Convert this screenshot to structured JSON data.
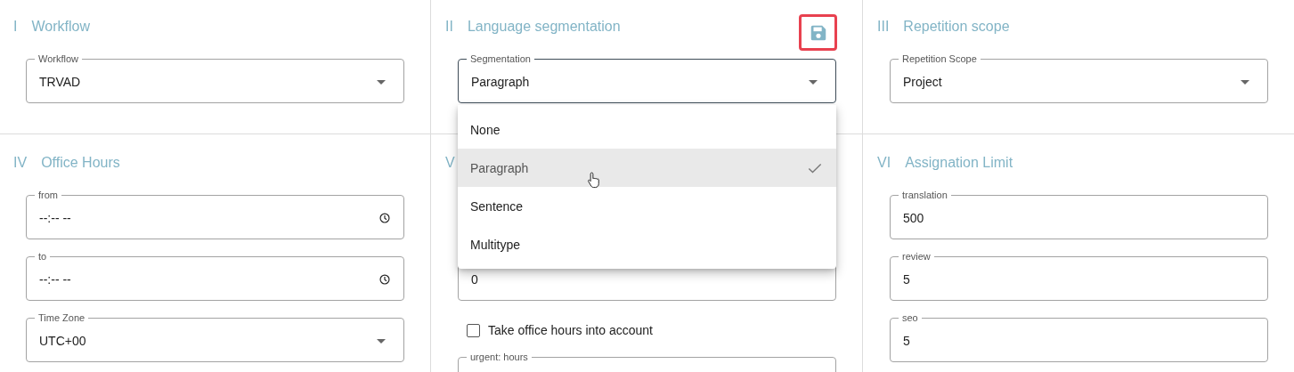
{
  "sections": [
    {
      "numeral": "I",
      "title": "Workflow",
      "fields": [
        {
          "kind": "select",
          "label": "Workflow",
          "value": "TRVAD"
        }
      ]
    },
    {
      "numeral": "II",
      "title": "Language segmentation",
      "save_button": true,
      "fields": [
        {
          "kind": "select",
          "label": "Segmentation",
          "value": "Paragraph",
          "focused": true,
          "expanded": true,
          "options": [
            {
              "label": "None",
              "selected": false
            },
            {
              "label": "Paragraph",
              "selected": true
            },
            {
              "label": "Sentence",
              "selected": false
            },
            {
              "label": "Multitype",
              "selected": false
            }
          ]
        }
      ]
    },
    {
      "numeral": "III",
      "title": "Repetition scope",
      "fields": [
        {
          "kind": "select",
          "label": "Repetition Scope",
          "value": "Project"
        }
      ]
    },
    {
      "numeral": "IV",
      "title": "Office Hours",
      "fields": [
        {
          "kind": "time",
          "label": "from",
          "value": "--:-- --"
        },
        {
          "kind": "time",
          "label": "to",
          "value": "--:-- --"
        },
        {
          "kind": "select",
          "label": "Time Zone",
          "value": "UTC+00"
        }
      ]
    },
    {
      "numeral": "V",
      "fields": [
        {
          "kind": "text",
          "value": "0"
        },
        {
          "kind": "checkbox",
          "label": "Take office hours into account",
          "checked": false
        },
        {
          "kind": "text",
          "label": "urgent: hours"
        }
      ]
    },
    {
      "numeral": "VI",
      "title": "Assignation Limit",
      "fields": [
        {
          "kind": "text",
          "label": "translation",
          "value": "500"
        },
        {
          "kind": "text",
          "label": "review",
          "value": "5"
        },
        {
          "kind": "text",
          "label": "seo",
          "value": "5"
        }
      ]
    }
  ]
}
